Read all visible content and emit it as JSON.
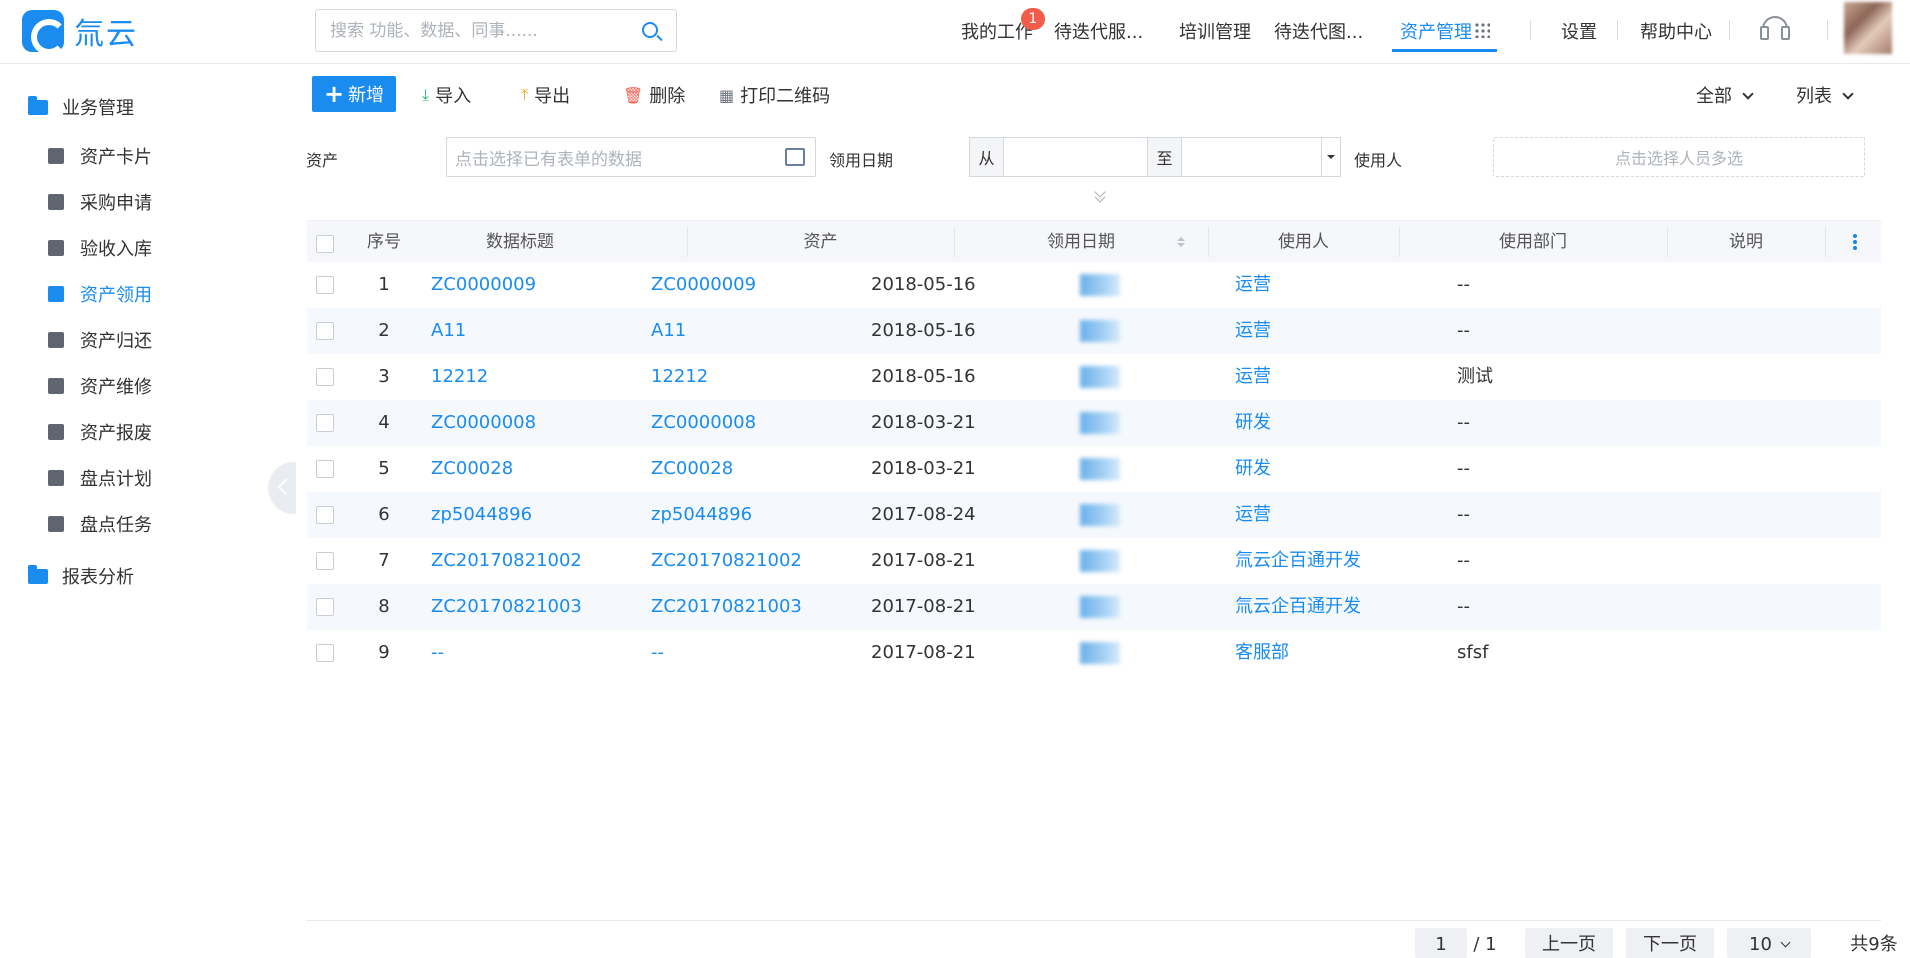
{
  "header": {
    "logo_text": "氚云",
    "search_placeholder": "搜索 功能、数据、同事......",
    "nav": [
      "我的工作",
      "待迭代服...",
      "培训管理",
      "待迭代图...",
      "资产管理"
    ],
    "badge_count": "1",
    "settings": "设置",
    "help": "帮助中心"
  },
  "sidebar": {
    "group1": "业务管理",
    "items": [
      "资产卡片",
      "采购申请",
      "验收入库",
      "资产领用",
      "资产归还",
      "资产维修",
      "资产报废",
      "盘点计划",
      "盘点任务"
    ],
    "active_index": 3,
    "group2": "报表分析"
  },
  "toolbar": {
    "new": "新增",
    "import": "导入",
    "export": "导出",
    "delete": "删除",
    "print_qr": "打印二维码",
    "filter_all": "全部",
    "view_mode": "列表"
  },
  "filters": {
    "asset_label": "资产",
    "asset_placeholder": "点击选择已有表单的数据",
    "date_label": "领用日期",
    "date_from": "从",
    "date_to": "至",
    "user_label": "使用人",
    "user_placeholder": "点击选择人员多选"
  },
  "table": {
    "columns": [
      "序号",
      "数据标题",
      "资产",
      "领用日期",
      "使用人",
      "使用部门",
      "说明"
    ],
    "rows": [
      {
        "no": "1",
        "title": "ZC0000009",
        "asset": "ZC0000009",
        "date": "2018-05-16",
        "dept": "运营",
        "note": "--"
      },
      {
        "no": "2",
        "title": "A11",
        "asset": "A11",
        "date": "2018-05-16",
        "dept": "运营",
        "note": "--"
      },
      {
        "no": "3",
        "title": "12212",
        "asset": "12212",
        "date": "2018-05-16",
        "dept": "运营",
        "note": "测试"
      },
      {
        "no": "4",
        "title": "ZC0000008",
        "asset": "ZC0000008",
        "date": "2018-03-21",
        "dept": "研发",
        "note": "--"
      },
      {
        "no": "5",
        "title": "ZC00028",
        "asset": "ZC00028",
        "date": "2018-03-21",
        "dept": "研发",
        "note": "--"
      },
      {
        "no": "6",
        "title": "zp5044896",
        "asset": "zp5044896",
        "date": "2017-08-24",
        "dept": "运营",
        "note": "--"
      },
      {
        "no": "7",
        "title": "ZC20170821002",
        "asset": "ZC20170821002",
        "date": "2017-08-21",
        "dept": "氚云企百通开发",
        "note": "--"
      },
      {
        "no": "8",
        "title": "ZC20170821003",
        "asset": "ZC20170821003",
        "date": "2017-08-21",
        "dept": "氚云企百通开发",
        "note": "--"
      },
      {
        "no": "9",
        "title": "--",
        "asset": "--",
        "date": "2017-08-21",
        "dept": "客服部",
        "note": "sfsf"
      }
    ]
  },
  "pager": {
    "current": "1",
    "total_pages": "/ 1",
    "prev": "上一页",
    "next": "下一页",
    "page_size": "10",
    "total": "共9条"
  },
  "colors": {
    "accent": "#1a8cf0",
    "badge": "#f25c4b"
  }
}
